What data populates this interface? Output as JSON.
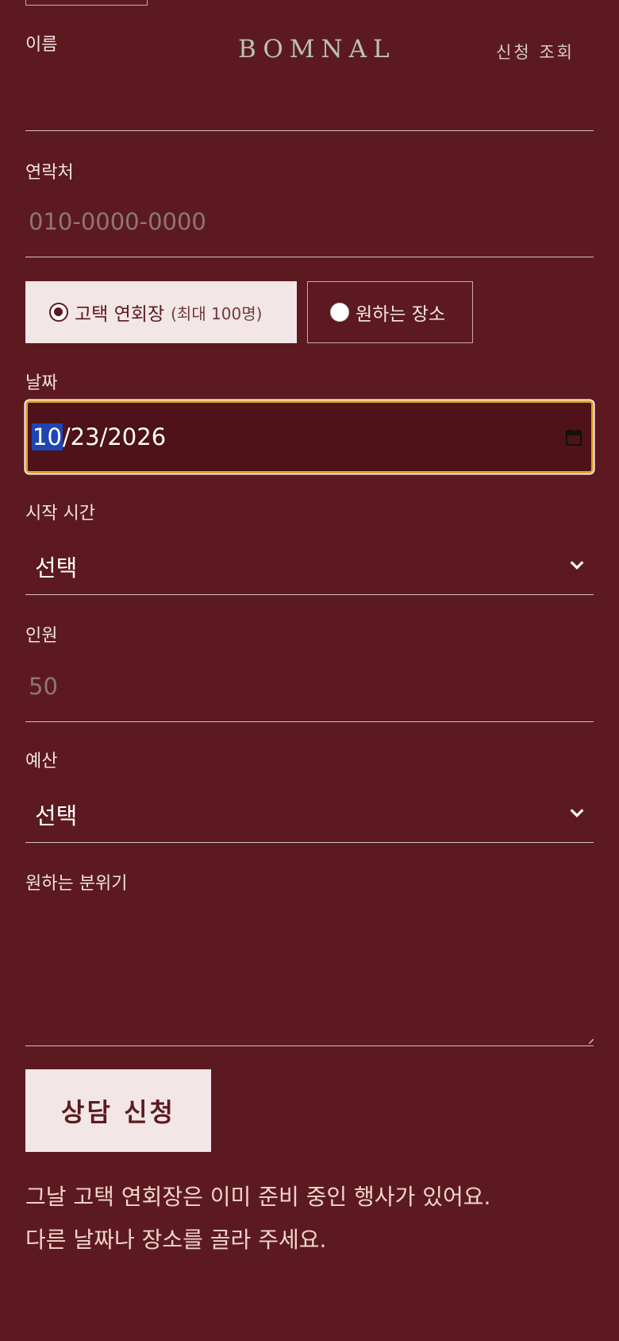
{
  "header": {
    "brand": "BOMNAL",
    "lookup_link": "신청 조회"
  },
  "form": {
    "name": {
      "label": "이름",
      "value": ""
    },
    "phone": {
      "label": "연락처",
      "placeholder": "010-0000-0000"
    },
    "venue": {
      "options": [
        {
          "label": "고택 연회장",
          "sub": "(최대 100명)",
          "selected": true
        },
        {
          "label": "원하는 장소",
          "selected": false
        }
      ]
    },
    "date": {
      "label": "날짜",
      "month": "10",
      "rest": "/23/2026"
    },
    "start_time": {
      "label": "시작 시간",
      "value": "선택"
    },
    "guests": {
      "label": "인원",
      "placeholder": "50"
    },
    "budget": {
      "label": "예산",
      "value": "선택"
    },
    "mood": {
      "label": "원하는 분위기",
      "value": ""
    },
    "submit_label": "상담 신청"
  },
  "message": {
    "line1": "그날 고택 연회장은 이미 준비 중인 행사가 있어요.",
    "line2": "다른 날짜나 장소를 골라 주세요."
  },
  "colors": {
    "background": "#5c1a20",
    "accent": "#f3e6e6",
    "focus": "#e3a32f",
    "brand": "#b9c4b0"
  }
}
